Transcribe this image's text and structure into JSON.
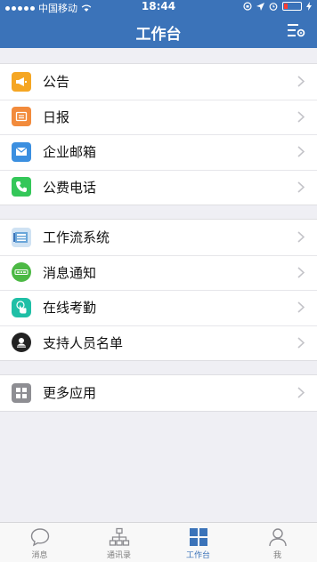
{
  "status_bar": {
    "carrier": "中国移动",
    "time": "18:44"
  },
  "header": {
    "title": "工作台"
  },
  "groups": [
    {
      "items": [
        {
          "label": "公告",
          "icon": "megaphone-icon",
          "color": "#f5a623"
        },
        {
          "label": "日报",
          "icon": "report-icon",
          "color": "#f28b3c"
        },
        {
          "label": "企业邮箱",
          "icon": "mail-icon",
          "color": "#3b8fe0"
        },
        {
          "label": "公费电话",
          "icon": "phone-icon",
          "color": "#34c759"
        }
      ]
    },
    {
      "items": [
        {
          "label": "工作流系统",
          "icon": "workflow-icon",
          "color": "#6aa6d9"
        },
        {
          "label": "消息通知",
          "icon": "notification-icon",
          "color": "#4cb944"
        },
        {
          "label": "在线考勤",
          "icon": "attendance-icon",
          "color": "#1fbfa6"
        },
        {
          "label": "支持人员名单",
          "icon": "support-icon",
          "color": "#222222"
        }
      ]
    },
    {
      "items": [
        {
          "label": "更多应用",
          "icon": "grid-icon",
          "color": "#8e8e93"
        }
      ]
    }
  ],
  "tabbar": {
    "tabs": [
      {
        "label": "消息",
        "icon": "chat-bubble-icon",
        "active": false
      },
      {
        "label": "通讯录",
        "icon": "org-chart-icon",
        "active": false
      },
      {
        "label": "工作台",
        "icon": "workbench-icon",
        "active": true
      },
      {
        "label": "我",
        "icon": "person-icon",
        "active": false
      }
    ]
  },
  "colors": {
    "accent": "#3b73b9",
    "background": "#efeff4"
  }
}
